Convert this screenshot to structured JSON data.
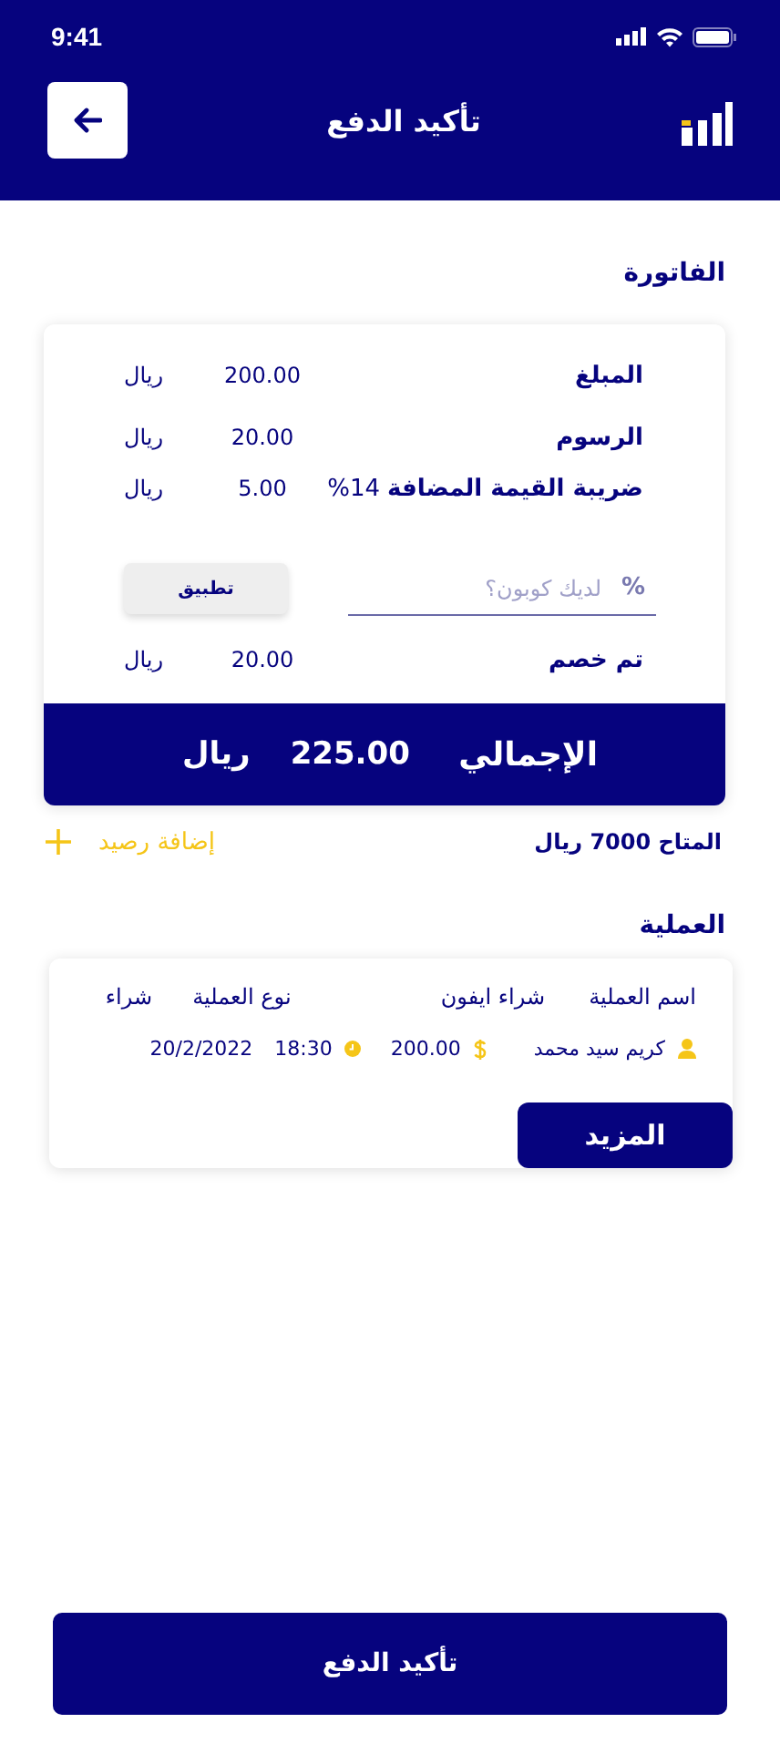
{
  "status_bar": {
    "time": "9:41"
  },
  "header": {
    "title": "تأكيد الدفع"
  },
  "invoice": {
    "title": "الفاتورة",
    "rows": [
      {
        "label": "المبلغ",
        "amount": "200.00",
        "currency": "ريال"
      },
      {
        "label": "الرسوم",
        "amount": "20.00",
        "currency": "ريال"
      },
      {
        "label": "ضريبة القيمة المضافة",
        "rate": "14%",
        "amount": "5.00",
        "currency": "ريال"
      }
    ],
    "coupon": {
      "symbol": "%",
      "placeholder": "لديك كوبون؟",
      "apply_button": "تطبيق"
    },
    "discount": {
      "label": "تم خصم",
      "amount": "20.00",
      "currency": "ريال"
    },
    "total": {
      "label": "الإجمالي",
      "amount": "225.00",
      "currency": "ريال"
    }
  },
  "balance": {
    "text": "المتاح 7000 ريال",
    "add_button": "إضافة رصيد"
  },
  "transaction": {
    "title": "العملية",
    "name_label": "اسم العملية",
    "name_value": "شراء ايفون",
    "type_label": "نوع العملية",
    "type_value": "شراء",
    "person": "كريم سيد محمد",
    "amount": "200.00",
    "time": "18:30",
    "date": "20/2/2022",
    "more_button": "المزيد"
  },
  "confirm_button": "تأكيد الدفع"
}
